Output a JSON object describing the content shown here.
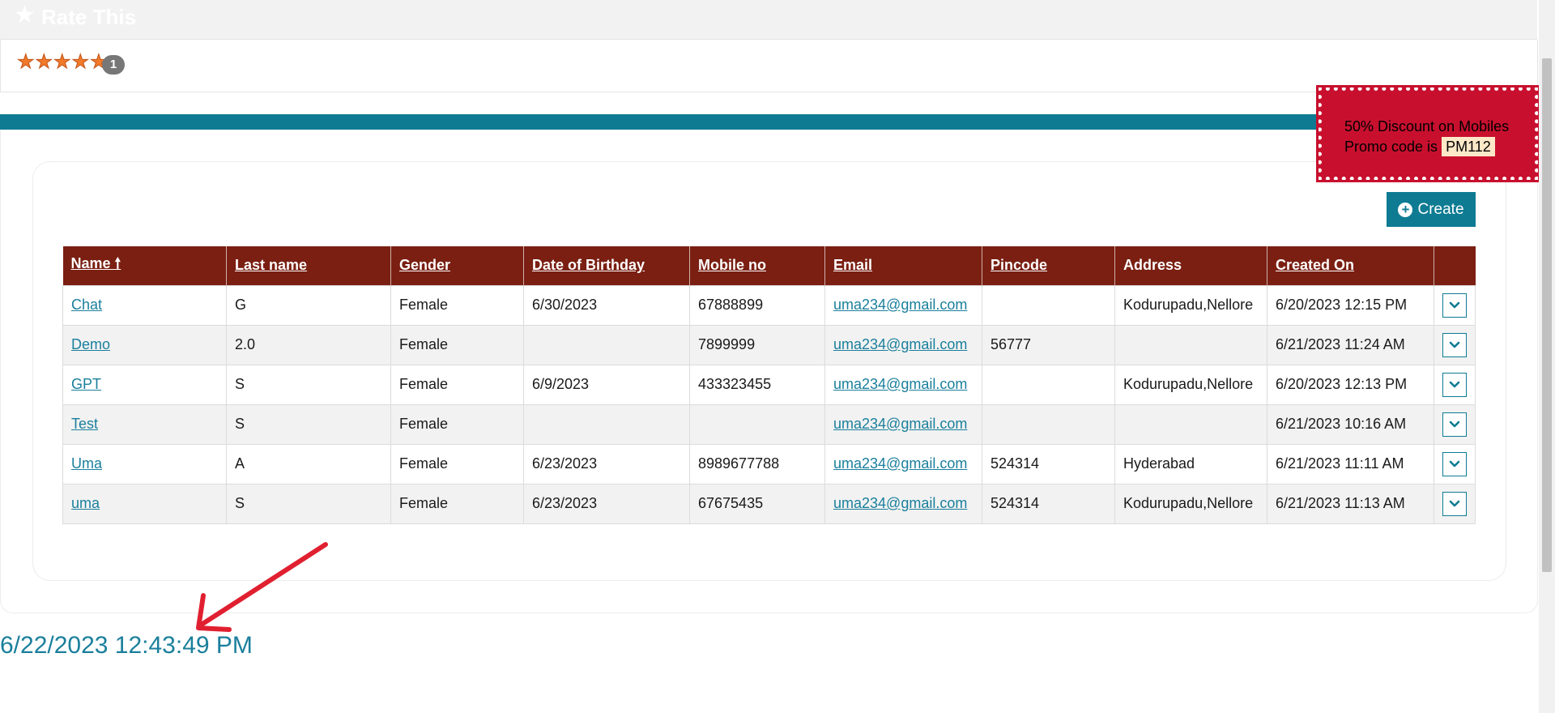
{
  "rate_section": {
    "title": "Rate This",
    "star_count": 5,
    "rating_count": "1"
  },
  "promo": {
    "line1": "50% Discount on Mobiles",
    "line2_prefix": "Promo code is",
    "code": "PM112"
  },
  "toolbar": {
    "create_label": "Create"
  },
  "table": {
    "headers": {
      "name": "Name",
      "last_name": "Last name",
      "gender": "Gender",
      "dob": "Date of Birthday",
      "mobile": "Mobile no",
      "email": "Email",
      "pincode": "Pincode",
      "address": "Address",
      "created_on": "Created On"
    },
    "sort_indicator": "🠕",
    "rows": [
      {
        "name": "Chat",
        "last_name": "G",
        "gender": "Female",
        "dob": "6/30/2023",
        "mobile": "67888899",
        "email": "uma234@gmail.com",
        "pincode": "",
        "address": "Kodurupadu,Nellore",
        "created_on": "6/20/2023 12:15 PM"
      },
      {
        "name": "Demo",
        "last_name": "2.0",
        "gender": "Female",
        "dob": "",
        "mobile": "7899999",
        "email": "uma234@gmail.com",
        "pincode": "56777",
        "address": "",
        "created_on": "6/21/2023 11:24 AM"
      },
      {
        "name": "GPT",
        "last_name": "S",
        "gender": "Female",
        "dob": "6/9/2023",
        "mobile": "433323455",
        "email": "uma234@gmail.com",
        "pincode": "",
        "address": "Kodurupadu,Nellore",
        "created_on": "6/20/2023 12:13 PM"
      },
      {
        "name": "Test",
        "last_name": "S",
        "gender": "Female",
        "dob": "",
        "mobile": "",
        "email": "uma234@gmail.com",
        "pincode": "",
        "address": "",
        "created_on": "6/21/2023 10:16 AM"
      },
      {
        "name": "Uma",
        "last_name": "A",
        "gender": "Female",
        "dob": "6/23/2023",
        "mobile": "8989677788",
        "email": "uma234@gmail.com",
        "pincode": "524314",
        "address": "Hyderabad",
        "created_on": "6/21/2023 11:11 AM"
      },
      {
        "name": "uma",
        "last_name": "S",
        "gender": "Female",
        "dob": "6/23/2023",
        "mobile": "67675435",
        "email": "uma234@gmail.com",
        "pincode": "524314",
        "address": "Kodurupadu,Nellore",
        "created_on": "6/21/2023 11:13 AM"
      }
    ]
  },
  "footer": {
    "timestamp": "6/22/2023 12:43:49 PM"
  },
  "colors": {
    "header_bg": "#7a1f12",
    "accent": "#0e7b93",
    "promo_bg": "#c8102e",
    "link": "#1a7f9c",
    "annotation_arrow": "#e02030"
  },
  "icons": {
    "header_star": "star-icon",
    "create": "plus-circle-icon",
    "row_action": "chevron-down-icon",
    "annotation": "arrow-icon"
  }
}
